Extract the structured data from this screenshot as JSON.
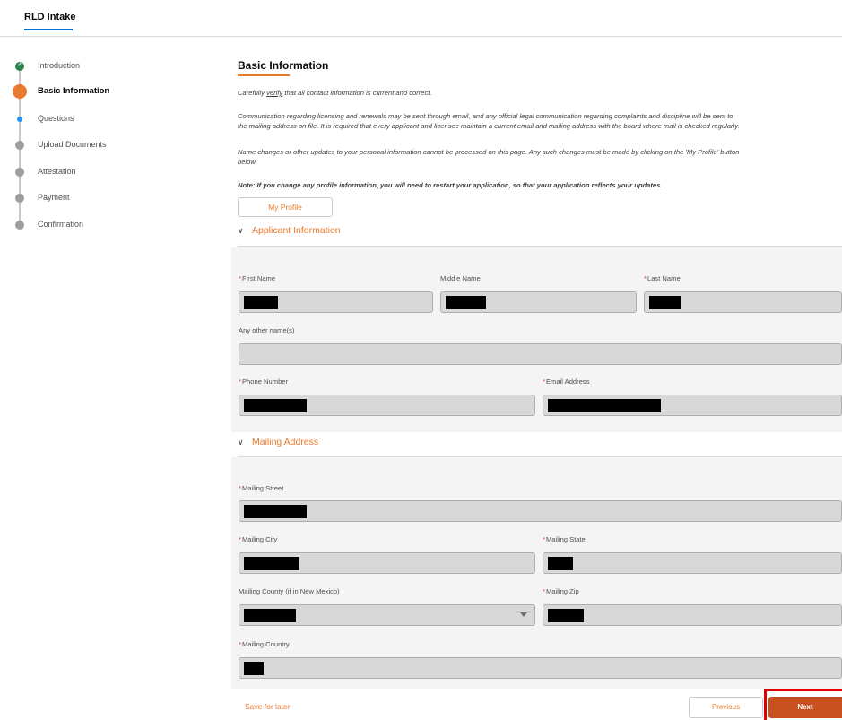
{
  "app": {
    "tab_label": "RLD Intake"
  },
  "stepper": {
    "steps": [
      {
        "label": "Introduction",
        "state": "done"
      },
      {
        "label": "Basic Information",
        "state": "current"
      },
      {
        "label": "Questions",
        "state": "next"
      },
      {
        "label": "Upload Documents",
        "state": "todo"
      },
      {
        "label": "Attestation",
        "state": "todo"
      },
      {
        "label": "Payment",
        "state": "todo"
      },
      {
        "label": "Confirmation",
        "state": "todo"
      }
    ]
  },
  "main": {
    "title": "Basic Information",
    "para1_prefix": "Carefully ",
    "para1_underlined": "verify",
    "para1_suffix": " that all contact information is current and correct.",
    "para2_line1": "Communication regarding licensing and renewals may be sent through email, and any official legal communication regarding complaints and discipline will be sent to",
    "para2_line2": "the mailing address on file. It is required that every applicant and licensee maintain a current email and mailing address with the board where mail is checked regularly.",
    "para3_line1": "Name changes or other updates to your personal information cannot be processed on this page. Any such changes must be made by clicking on the 'My Profile' button",
    "para3_line2": "below.",
    "note": "Note: If you change any profile information, you will need to restart your application, so that your application reflects your updates.",
    "profile_button": "My Profile"
  },
  "applicant": {
    "section_title": "Applicant Information",
    "first_name_label": "First Name",
    "middle_name_label": "Middle Name",
    "last_name_label": "Last Name",
    "other_names_label": "Any other name(s)",
    "phone_label": "Phone Number",
    "email_label": "Email Address"
  },
  "mailing": {
    "section_title": "Mailing Address",
    "street_label": "Mailing Street",
    "city_label": "Mailing City",
    "state_label": "Mailing State",
    "county_label": "Mailing County (if in New Mexico)",
    "zip_label": "Mailing Zip",
    "country_label": "Mailing Country"
  },
  "footer": {
    "save_later": "Save for later",
    "previous": "Previous",
    "next": "Next"
  },
  "colors": {
    "accent": "#e87a2d",
    "next_button": "#c8501f",
    "done": "#2e844a",
    "in_progress": "#1b96ff",
    "highlight_box": "#e00000"
  }
}
